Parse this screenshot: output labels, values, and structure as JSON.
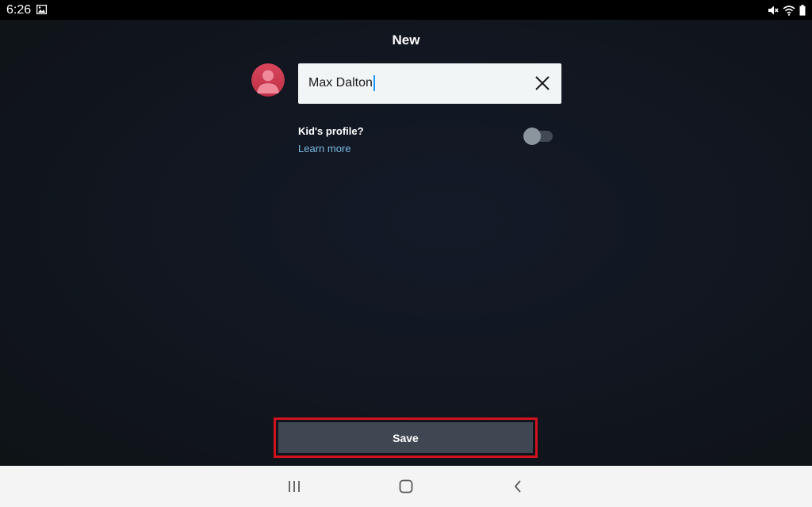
{
  "status_bar": {
    "time": "6:26",
    "icons": [
      "image-icon",
      "mute-icon",
      "wifi-icon",
      "battery-icon"
    ]
  },
  "screen": {
    "title": "New",
    "name_input": {
      "value": "Max Dalton",
      "placeholder": ""
    },
    "kids_profile": {
      "label": "Kid's profile?",
      "learn_more": "Learn more",
      "enabled": false
    },
    "save_label": "Save"
  },
  "nav_bar": {
    "icons": [
      "recent-apps-icon",
      "home-icon",
      "back-icon"
    ]
  },
  "colors": {
    "background": "#0f1419",
    "accent_highlight": "#d1121e",
    "link": "#79b8e0",
    "avatar": "#d9465c",
    "button": "#3f4852"
  }
}
